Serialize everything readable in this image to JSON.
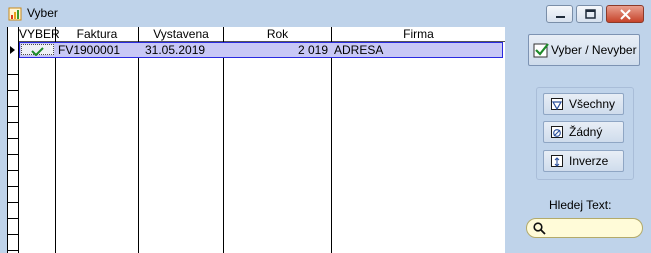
{
  "window": {
    "title": "Vyber"
  },
  "grid": {
    "columns": [
      "VYBER",
      "Faktura",
      "Vystavena",
      "Rok",
      "Firma"
    ],
    "rows": [
      {
        "vyber": true,
        "faktura": "FV1900001",
        "vystavena": "31.05.2019",
        "rok": "2 019",
        "firma": "ADRESA"
      }
    ]
  },
  "panel": {
    "main_button": "Vyber / Nevyber",
    "select_all": "Všechny",
    "select_none": "Žádný",
    "invert": "Inverze",
    "search_label": "Hledej Text:",
    "search_value": ""
  },
  "colors": {
    "selected_row": "#c8c8f6",
    "window_bg": "#bfd3ea",
    "search_bg": "#fffbd8"
  }
}
